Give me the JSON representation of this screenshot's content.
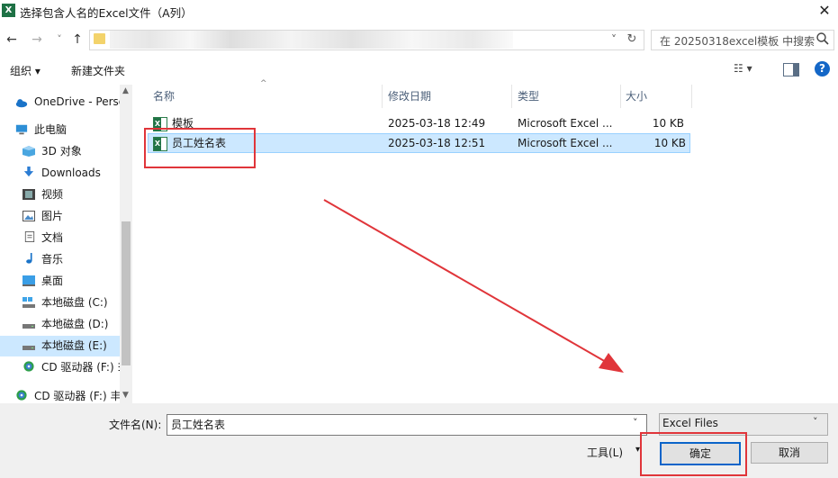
{
  "window": {
    "title": "选择包含人名的Excel文件（A列）",
    "app_icon": "X",
    "close_glyph": "✕"
  },
  "nav": {
    "back": "←",
    "forward": "→",
    "recent": "˅",
    "up": "↑",
    "refresh": "↻",
    "addr_drop": "˅"
  },
  "search": {
    "placeholder": "在 20250318excel模板 中搜索"
  },
  "toolbar": {
    "organize": "组织 ▾",
    "new_folder": "新建文件夹",
    "view": "☷ ▾",
    "help": "?"
  },
  "navpane": {
    "items": [
      {
        "label": "OneDrive - Perso",
        "icon": "cloud-icon"
      },
      {
        "label": "此电脑",
        "icon": "computer-icon"
      },
      {
        "label": "3D 对象",
        "icon": "cube-icon"
      },
      {
        "label": "Downloads",
        "icon": "download-icon"
      },
      {
        "label": "视频",
        "icon": "video-icon"
      },
      {
        "label": "图片",
        "icon": "picture-icon"
      },
      {
        "label": "文档",
        "icon": "document-icon"
      },
      {
        "label": "音乐",
        "icon": "music-icon"
      },
      {
        "label": "桌面",
        "icon": "desktop-icon"
      },
      {
        "label": "本地磁盘 (C:)",
        "icon": "drive-icon"
      },
      {
        "label": "本地磁盘 (D:)",
        "icon": "drive-icon"
      },
      {
        "label": "本地磁盘 (E:)",
        "icon": "drive-icon"
      },
      {
        "label": "CD 驱动器 (F:) ∃",
        "icon": "cd-icon"
      },
      {
        "label": "CD 驱动器 (F:) 丰",
        "icon": "cd-icon"
      }
    ],
    "selected_index": 11
  },
  "columns": {
    "name": "名称",
    "modified": "修改日期",
    "type": "类型",
    "size": "大小",
    "sort_glyph": "^"
  },
  "files": [
    {
      "name": "模板",
      "modified": "2025-03-18 12:49",
      "type": "Microsoft Excel ...",
      "size": "10 KB"
    },
    {
      "name": "员工姓名表",
      "modified": "2025-03-18 12:51",
      "type": "Microsoft Excel ...",
      "size": "10 KB"
    }
  ],
  "bottom": {
    "filename_label": "文件名(N):",
    "filename_value": "员工姓名表",
    "filter_value": "Excel Files",
    "tools": "工具(L)",
    "tools_arrow": "▾",
    "ok": "确定",
    "cancel": "取消",
    "drop": "˅"
  },
  "colors": {
    "accent": "#0a64c9",
    "selection": "#cce8ff",
    "annotation": "#e0353a",
    "excel": "#217346"
  }
}
